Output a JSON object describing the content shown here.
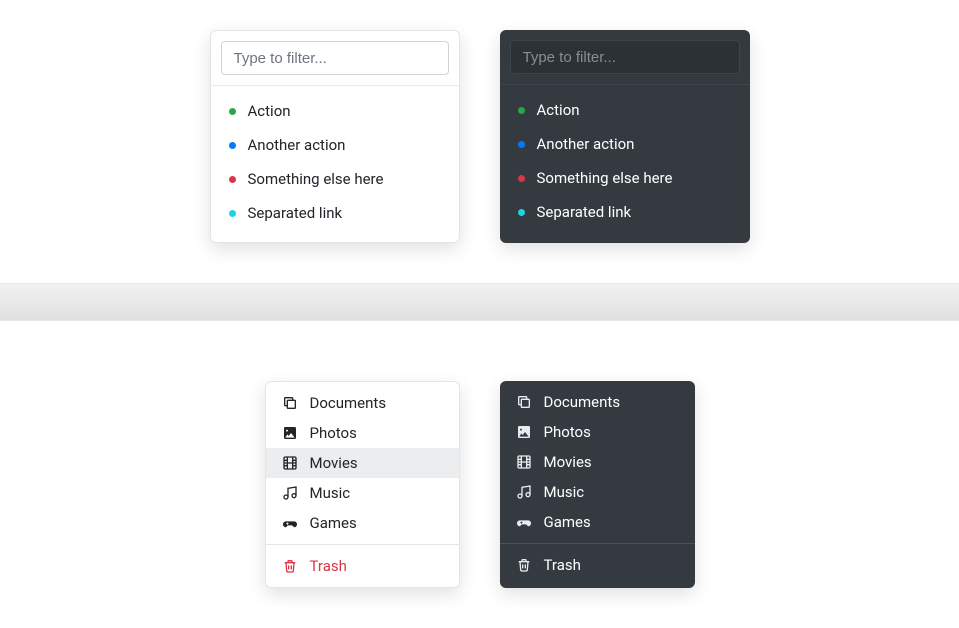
{
  "filter": {
    "placeholder": "Type to filter..."
  },
  "colors": {
    "green": "#28a745",
    "blue": "#007bff",
    "red": "#dc3545",
    "cyan": "#17d4e6"
  },
  "dotMenu": {
    "items": [
      {
        "label": "Action",
        "color": "green"
      },
      {
        "label": "Another action",
        "color": "blue"
      },
      {
        "label": "Something else here",
        "color": "red"
      },
      {
        "label": "Separated link",
        "color": "cyan"
      }
    ]
  },
  "iconMenu": {
    "items": [
      {
        "label": "Documents",
        "icon": "copy"
      },
      {
        "label": "Photos",
        "icon": "image"
      },
      {
        "label": "Movies",
        "icon": "film"
      },
      {
        "label": "Music",
        "icon": "music"
      },
      {
        "label": "Games",
        "icon": "gamepad"
      }
    ],
    "trash": {
      "label": "Trash",
      "icon": "trash"
    }
  },
  "activeLightIndex": 2
}
